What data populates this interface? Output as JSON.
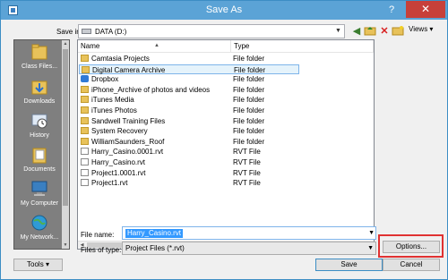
{
  "window": {
    "title": "Save As",
    "help": "?",
    "close": "✕"
  },
  "toolbar": {
    "save_in_label": "Save in:",
    "save_in_value": "DATA (D:)",
    "views_label": "Views"
  },
  "places": [
    {
      "label": "Class Files..."
    },
    {
      "label": "Downloads"
    },
    {
      "label": "History"
    },
    {
      "label": "Documents"
    },
    {
      "label": "My Computer"
    },
    {
      "label": "My Network..."
    }
  ],
  "file_list": {
    "headers": {
      "name": "Name",
      "type": "Type"
    },
    "rows": [
      {
        "name": "Camtasia Projects",
        "type": "File folder",
        "icon": "folder"
      },
      {
        "name": "Digital Camera Archive",
        "type": "File folder",
        "icon": "folder"
      },
      {
        "name": "Dropbox",
        "type": "File folder",
        "icon": "dropbox"
      },
      {
        "name": "iPhone_Archive of photos and videos",
        "type": "File folder",
        "icon": "folder"
      },
      {
        "name": "iTunes Media",
        "type": "File folder",
        "icon": "folder"
      },
      {
        "name": "iTunes Photos",
        "type": "File folder",
        "icon": "folder"
      },
      {
        "name": "Sandwell Training Files",
        "type": "File folder",
        "icon": "folder"
      },
      {
        "name": "System Recovery",
        "type": "File folder",
        "icon": "folder"
      },
      {
        "name": "WilliamSaunders_Roof",
        "type": "File folder",
        "icon": "folder"
      },
      {
        "name": "Harry_Casino.0001.rvt",
        "type": "RVT File",
        "icon": "rvt"
      },
      {
        "name": "Harry_Casino.rvt",
        "type": "RVT File",
        "icon": "rvt"
      },
      {
        "name": "Project1.0001.rvt",
        "type": "RVT File",
        "icon": "rvt"
      },
      {
        "name": "Project1.rvt",
        "type": "RVT File",
        "icon": "rvt"
      }
    ]
  },
  "form": {
    "file_name_label": "File name:",
    "file_name_value": "Harry_Casino.rvt",
    "file_type_label": "Files of type:",
    "file_type_value": "Project Files  (*.rvt)"
  },
  "buttons": {
    "tools": "Tools",
    "options": "Options...",
    "save": "Save",
    "cancel": "Cancel"
  },
  "colors": {
    "accent": "#5ba3d6",
    "highlight": "#e03232",
    "folder": "#e8c25a"
  }
}
